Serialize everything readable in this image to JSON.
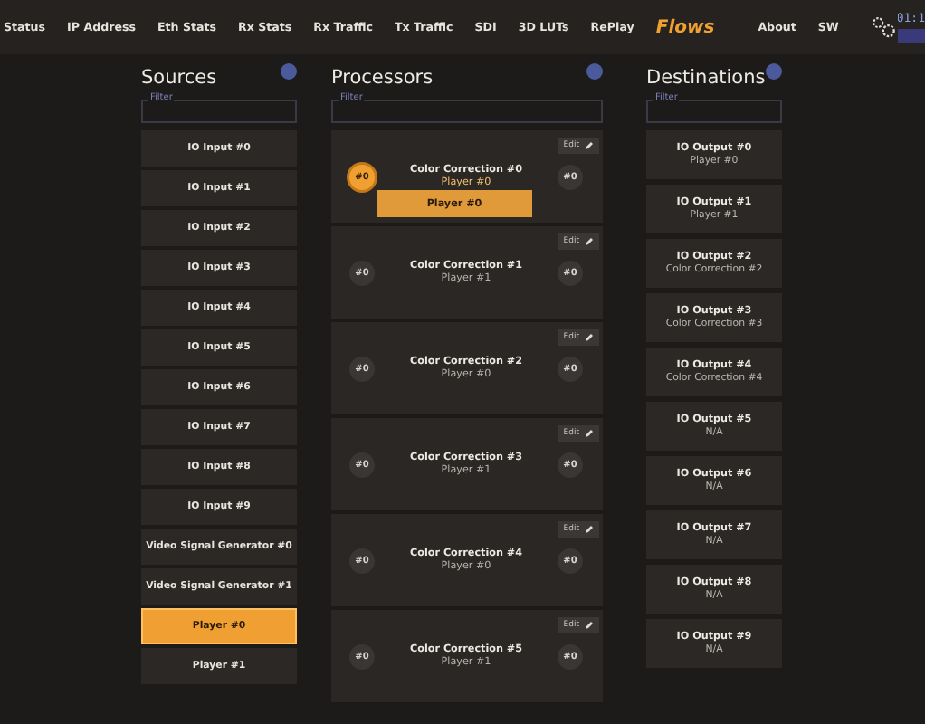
{
  "nav": {
    "items": [
      {
        "label": "Status",
        "selected": false
      },
      {
        "label": "IP Address",
        "selected": false
      },
      {
        "label": "Eth Stats",
        "selected": false
      },
      {
        "label": "Rx Stats",
        "selected": false
      },
      {
        "label": "Rx Traffic",
        "selected": false
      },
      {
        "label": "Tx Traffic",
        "selected": false
      },
      {
        "label": "SDI",
        "selected": false
      },
      {
        "label": "3D LUTs",
        "selected": false
      },
      {
        "label": "RePlay",
        "selected": false
      },
      {
        "label": "Flows",
        "selected": true
      },
      {
        "label": "About",
        "selected": false
      },
      {
        "label": "SW",
        "selected": false
      }
    ],
    "clock": "01:1"
  },
  "sources": {
    "title": "Sources",
    "filter_label": "Filter",
    "items": [
      {
        "label": "IO Input #0",
        "selected": false
      },
      {
        "label": "IO Input #1",
        "selected": false
      },
      {
        "label": "IO Input #2",
        "selected": false
      },
      {
        "label": "IO Input #3",
        "selected": false
      },
      {
        "label": "IO Input #4",
        "selected": false
      },
      {
        "label": "IO Input #5",
        "selected": false
      },
      {
        "label": "IO Input #6",
        "selected": false
      },
      {
        "label": "IO Input #7",
        "selected": false
      },
      {
        "label": "IO Input #8",
        "selected": false
      },
      {
        "label": "IO Input #9",
        "selected": false
      },
      {
        "label": "Video Signal Generator #0",
        "selected": false
      },
      {
        "label": "Video Signal Generator #1",
        "selected": false
      },
      {
        "label": "Player #0",
        "selected": true
      },
      {
        "label": "Player #1",
        "selected": false
      }
    ]
  },
  "processors": {
    "title": "Processors",
    "filter_label": "Filter",
    "items": [
      {
        "name": "Color Correction #0",
        "input": "Player #0",
        "in_port": "#0",
        "out_port": "#0",
        "edit": "Edit",
        "drop_target": true,
        "drag_label": "Player #0"
      },
      {
        "name": "Color Correction #1",
        "input": "Player #1",
        "in_port": "#0",
        "out_port": "#0",
        "edit": "Edit",
        "drop_target": false
      },
      {
        "name": "Color Correction #2",
        "input": "Player #0",
        "in_port": "#0",
        "out_port": "#0",
        "edit": "Edit",
        "drop_target": false
      },
      {
        "name": "Color Correction #3",
        "input": "Player #1",
        "in_port": "#0",
        "out_port": "#0",
        "edit": "Edit",
        "drop_target": false
      },
      {
        "name": "Color Correction #4",
        "input": "Player #0",
        "in_port": "#0",
        "out_port": "#0",
        "edit": "Edit",
        "drop_target": false
      },
      {
        "name": "Color Correction #5",
        "input": "Player #1",
        "in_port": "#0",
        "out_port": "#0",
        "edit": "Edit",
        "drop_target": false
      }
    ]
  },
  "destinations": {
    "title": "Destinations",
    "filter_label": "Filter",
    "items": [
      {
        "name": "IO Output #0",
        "source": "Player #0"
      },
      {
        "name": "IO Output #1",
        "source": "Player #1"
      },
      {
        "name": "IO Output #2",
        "source": "Color Correction #2"
      },
      {
        "name": "IO Output #3",
        "source": "Color Correction #3"
      },
      {
        "name": "IO Output #4",
        "source": "Color Correction #4"
      },
      {
        "name": "IO Output #5",
        "source": "N/A"
      },
      {
        "name": "IO Output #6",
        "source": "N/A"
      },
      {
        "name": "IO Output #7",
        "source": "N/A"
      },
      {
        "name": "IO Output #8",
        "source": "N/A"
      },
      {
        "name": "IO Output #9",
        "source": "N/A"
      }
    ]
  }
}
